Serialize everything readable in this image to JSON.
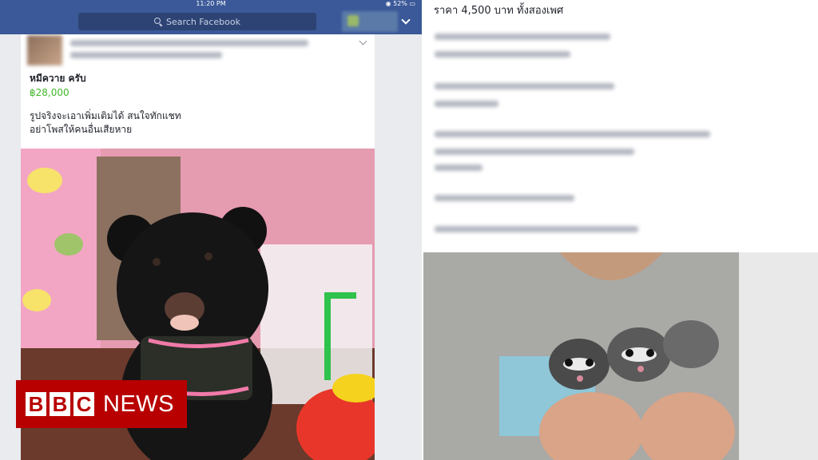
{
  "status_bar": {
    "time": "11:20 PM",
    "battery": "52%"
  },
  "fb_header": {
    "search_placeholder": "Search Facebook"
  },
  "left_post": {
    "title": "หมีควาย ครับ",
    "price": "฿28,000",
    "description_line1": "รูปจริงจะเอาเพิ่มเติมได้ สนใจทักแชท",
    "description_line2": "อย่าโพสให้คนอื่นเสียหาย"
  },
  "logo": {
    "b1": "B",
    "b2": "B",
    "c": "C",
    "news": "NEWS"
  },
  "right_post": {
    "price_line": "ราคา 4,500 บาท ทั้งสองเพศ"
  },
  "colors": {
    "fb_blue": "#3b5998",
    "price_green": "#42b72a",
    "bbc_red": "#b80000"
  }
}
